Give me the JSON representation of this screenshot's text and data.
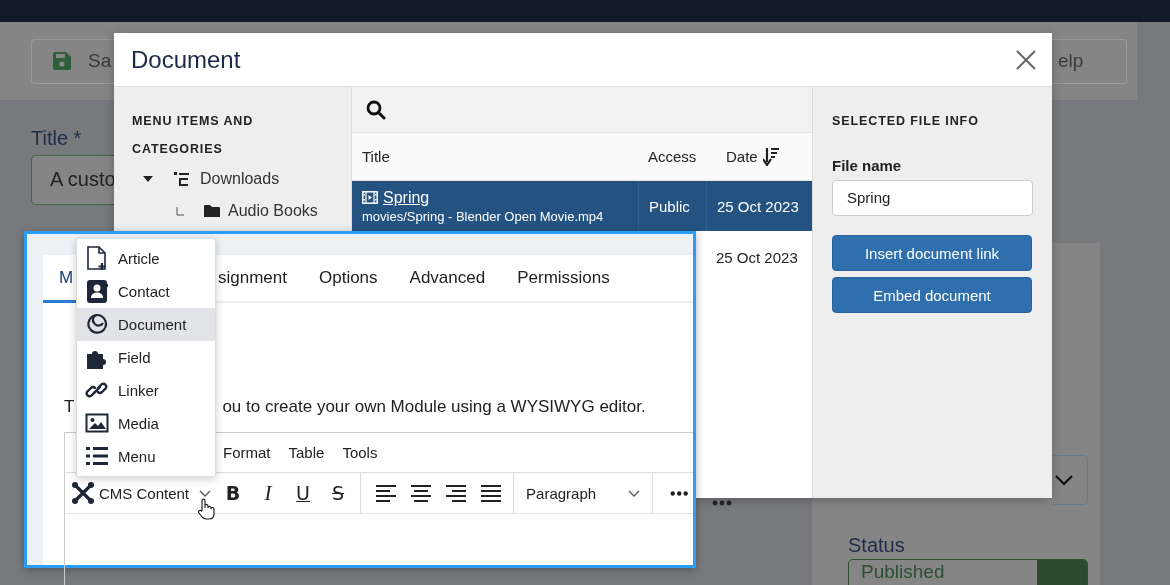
{
  "background_page": {
    "toolbar": {
      "buttons": [
        {
          "label": "Sa",
          "kind": "save"
        },
        {
          "label": "elp",
          "kind": "help"
        }
      ]
    },
    "title_field": {
      "label": "Title *",
      "value": "A custo"
    },
    "status_field": {
      "label": "Status",
      "value": "Published"
    }
  },
  "modal": {
    "title": "Document",
    "sidebar": {
      "heading": "MENU ITEMS AND CATEGORIES",
      "tree": [
        {
          "label": "Downloads",
          "expanded": true,
          "children": [
            {
              "label": "Audio Books"
            }
          ]
        }
      ]
    },
    "table": {
      "columns": [
        "Title",
        "Access",
        "Date"
      ],
      "rows": [
        {
          "title": "Spring",
          "path": "movies/Spring - Blender Open Movie.mp4",
          "access": "Public",
          "date": "25 Oct 2023",
          "selected": true
        },
        {
          "date": "25 Oct 2023",
          "selected": false
        }
      ]
    },
    "file_info": {
      "heading": "SELECTED FILE INFO",
      "field": {
        "label": "File name",
        "value": "Spring"
      },
      "buttons": [
        "Insert document link",
        "Embed document"
      ]
    }
  },
  "inset": {
    "tabs": [
      {
        "label": "M",
        "selected": true
      },
      {
        "label": "signment",
        "selected": false
      },
      {
        "label": "Options",
        "selected": false
      },
      {
        "label": "Advanced",
        "selected": false
      },
      {
        "label": "Permissions",
        "selected": false
      }
    ],
    "description": [
      "T",
      "ou to create your own Module using a WYSIWYG editor."
    ],
    "editor": {
      "menubar": [
        "Format",
        "Table",
        "Tools"
      ],
      "cms_button": "CMS Content",
      "format_buttons": [
        {
          "label": "B",
          "kind": "bold"
        },
        {
          "label": "I",
          "kind": "italic"
        },
        {
          "label": "U",
          "kind": "underline"
        },
        {
          "label": "S",
          "kind": "strike"
        }
      ],
      "block_select": "Paragraph"
    },
    "dropdown": [
      {
        "label": "Article",
        "kind": "article",
        "selected": false
      },
      {
        "label": "Contact",
        "kind": "contact",
        "selected": false
      },
      {
        "label": "Document",
        "kind": "document",
        "selected": true
      },
      {
        "label": "Field",
        "kind": "field",
        "selected": false
      },
      {
        "label": "Linker",
        "kind": "linker",
        "selected": false
      },
      {
        "label": "Media",
        "kind": "media",
        "selected": false
      },
      {
        "label": "Menu",
        "kind": "menu",
        "selected": false
      }
    ]
  }
}
